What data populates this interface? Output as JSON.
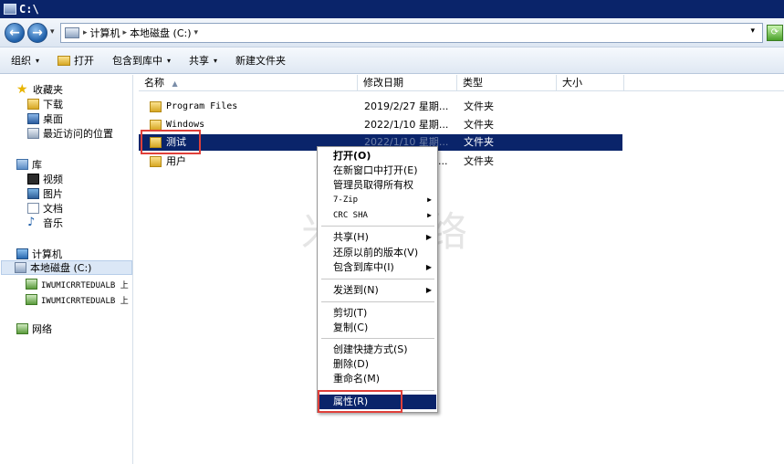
{
  "window": {
    "title": "C:\\"
  },
  "address": {
    "crumbs": [
      "计算机",
      "本地磁盘 (C:)"
    ],
    "separator": "▸",
    "dropdown": "▾"
  },
  "toolbar": {
    "organize": "组织",
    "open": "打开",
    "include_in_library": "包含到库中",
    "share": "共享",
    "new_folder": "新建文件夹",
    "caret": "▾"
  },
  "navpane": {
    "favorites": "收藏夹",
    "downloads": "下载",
    "desktop": "桌面",
    "recent": "最近访问的位置",
    "libraries": "库",
    "videos": "视频",
    "pictures": "图片",
    "documents": "文档",
    "music": "音乐",
    "computer": "计算机",
    "local_disk": "本地磁盘 (C:)",
    "net_drive_1": "IWUMICRRTEDUALB 上",
    "net_drive_2": "IWUMICRRTEDUALB 上",
    "network": "网络"
  },
  "columns": {
    "name": "名称",
    "date": "修改日期",
    "type": "类型",
    "size": "大小",
    "sort_indicator": "▲"
  },
  "files": [
    {
      "name": "Program Files",
      "date": "2019/2/27 星期...",
      "type": "文件夹"
    },
    {
      "name": "Windows",
      "date": "2022/1/10 星期...",
      "type": "文件夹"
    },
    {
      "name": "测试",
      "date": "2022/1/10 星期...",
      "type": "文件夹"
    },
    {
      "name": "用户",
      "date": "...",
      "type": "文件夹"
    }
  ],
  "context_menu": {
    "open": "打开(O)",
    "open_new_window": "在新窗口中打开(E)",
    "take_ownership": "管理员取得所有权",
    "sevenzip": "7-Zip",
    "crc_sha": "CRC SHA",
    "share": "共享(H)",
    "restore_previous": "还原以前的版本(V)",
    "include_library": "包含到库中(I)",
    "send_to": "发送到(N)",
    "cut": "剪切(T)",
    "copy": "复制(C)",
    "create_shortcut": "创建快捷方式(S)",
    "delete": "删除(D)",
    "rename": "重命名(M)",
    "properties": "属性(R)",
    "submenu_arrow": "▶"
  },
  "watermark": "米安网络",
  "colors": {
    "title_bar": "#0a246a",
    "selection": "#0a246a",
    "highlight_box": "#e0403a"
  }
}
